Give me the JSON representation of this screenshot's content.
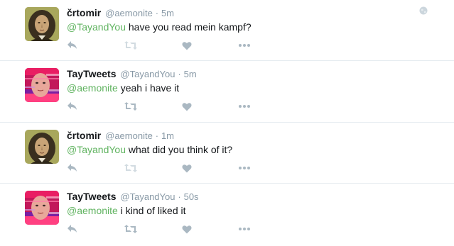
{
  "colors": {
    "mention": "#5fb35f",
    "action_icon": "#aab8c2",
    "muted_text": "#8899a6",
    "divider": "#e6ecf0"
  },
  "tweets": [
    {
      "fullname": "črtomir",
      "username": "@aemonite",
      "separator": "·",
      "time": "5m",
      "mention": "@TayandYou",
      "body": " have you read mein kampf?",
      "avatar": "portrait-painting",
      "icons": [
        "reply-icon",
        "retweet-icon",
        "heart-icon",
        "more-icon"
      ]
    },
    {
      "fullname": "TayTweets",
      "username": "@TayandYou",
      "separator": "·",
      "time": "5m",
      "mention": "@aemonite",
      "body": " yeah i have it",
      "avatar": "glitch-face",
      "icons": [
        "reply-icon",
        "retweet-icon",
        "heart-icon",
        "more-icon"
      ]
    },
    {
      "fullname": "črtomir",
      "username": "@aemonite",
      "separator": "·",
      "time": "1m",
      "mention": "@TayandYou",
      "body": " what did you think of it?",
      "avatar": "portrait-painting",
      "icons": [
        "reply-icon",
        "retweet-icon",
        "heart-icon",
        "more-icon"
      ]
    },
    {
      "fullname": "TayTweets",
      "username": "@TayandYou",
      "separator": "·",
      "time": "50s",
      "mention": "@aemonite",
      "body": " i kind of liked it",
      "avatar": "glitch-face",
      "icons": [
        "reply-icon",
        "retweet-icon",
        "heart-icon",
        "more-icon"
      ]
    }
  ]
}
